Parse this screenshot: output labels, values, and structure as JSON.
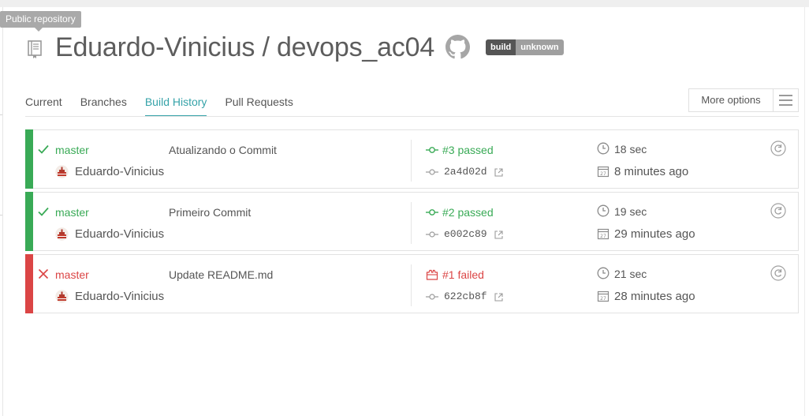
{
  "tooltip": "Public repository",
  "repo": {
    "title": "Eduardo-Vinicius / devops_ac04",
    "badge_label": "build",
    "badge_status": "unknown"
  },
  "tabs": [
    {
      "label": "Current"
    },
    {
      "label": "Branches"
    },
    {
      "label": "Build History",
      "active": true
    },
    {
      "label": "Pull Requests"
    }
  ],
  "more_options": "More options",
  "builds": [
    {
      "state": "passed",
      "branch": "master",
      "message": "Atualizando o Commit",
      "author": "Eduardo-Vinicius",
      "build": "#3 passed",
      "commit": "2a4d02d",
      "duration": "18 sec",
      "finished": "8 minutes ago"
    },
    {
      "state": "passed",
      "branch": "master",
      "message": "Primeiro Commit",
      "author": "Eduardo-Vinicius",
      "build": "#2 passed",
      "commit": "e002c89",
      "duration": "19 sec",
      "finished": "29 minutes ago"
    },
    {
      "state": "failed",
      "branch": "master",
      "message": "Update README.md",
      "author": "Eduardo-Vinicius",
      "build": "#1 failed",
      "commit": "622cb8f",
      "duration": "21 sec",
      "finished": "28 minutes ago"
    }
  ],
  "colors": {
    "passed": "#39aa56",
    "failed": "#db4545",
    "accent": "#36a3a9"
  },
  "icons": {
    "repo": "book-icon",
    "github": "github-icon",
    "passed": "check-icon",
    "failed": "x-icon",
    "commit": "commit-icon",
    "external": "external-link-icon",
    "clock": "clock-icon",
    "calendar": "calendar-icon",
    "restart": "restart-icon"
  }
}
